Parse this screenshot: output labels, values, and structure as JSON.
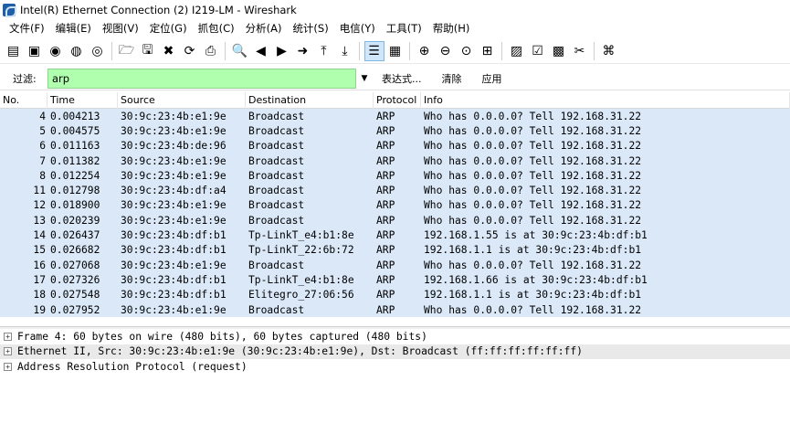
{
  "window": {
    "title": "Intel(R) Ethernet Connection (2) I219-LM - Wireshark"
  },
  "menu": [
    "文件(F)",
    "编辑(E)",
    "视图(V)",
    "定位(G)",
    "抓包(C)",
    "分析(A)",
    "统计(S)",
    "电信(Y)",
    "工具(T)",
    "帮助(H)"
  ],
  "toolbar": {
    "groups": [
      [
        {
          "name": "interfaces-icon",
          "glyph": "▤"
        },
        {
          "name": "capture-options-icon",
          "glyph": "▣"
        },
        {
          "name": "capture-start-icon",
          "glyph": "◉"
        },
        {
          "name": "capture-stop-icon",
          "glyph": "◍"
        },
        {
          "name": "capture-restart-icon",
          "glyph": "◎"
        }
      ],
      [
        {
          "name": "open-file-icon",
          "glyph": "🗁"
        },
        {
          "name": "save-file-icon",
          "glyph": "🖫"
        },
        {
          "name": "close-file-icon",
          "glyph": "✖"
        },
        {
          "name": "reload-icon",
          "glyph": "⟳"
        },
        {
          "name": "print-icon",
          "glyph": "⎙"
        }
      ],
      [
        {
          "name": "find-packet-icon",
          "glyph": "🔍"
        },
        {
          "name": "go-back-icon",
          "glyph": "◀"
        },
        {
          "name": "go-forward-icon",
          "glyph": "▶"
        },
        {
          "name": "go-to-packet-icon",
          "glyph": "➜"
        },
        {
          "name": "go-first-icon",
          "glyph": "⤒"
        },
        {
          "name": "go-last-icon",
          "glyph": "⤓"
        }
      ],
      [
        {
          "name": "colorize-icon",
          "glyph": "☰",
          "active": true
        },
        {
          "name": "autoscroll-icon",
          "glyph": "▦"
        }
      ],
      [
        {
          "name": "zoom-in-icon",
          "glyph": "⊕"
        },
        {
          "name": "zoom-out-icon",
          "glyph": "⊖"
        },
        {
          "name": "zoom-normal-icon",
          "glyph": "⊙"
        },
        {
          "name": "resize-columns-icon",
          "glyph": "⊞"
        }
      ],
      [
        {
          "name": "capture-filters-icon",
          "glyph": "▨"
        },
        {
          "name": "display-filters-icon",
          "glyph": "☑"
        },
        {
          "name": "coloring-rules-icon",
          "glyph": "▩"
        },
        {
          "name": "preferences-icon",
          "glyph": "✂"
        }
      ],
      [
        {
          "name": "help-icon",
          "glyph": "⌘"
        }
      ]
    ]
  },
  "filter": {
    "label": "过滤:",
    "value": "arp",
    "expression_label": "表达式...",
    "clear_label": "清除",
    "apply_label": "应用"
  },
  "packet_list": {
    "columns": [
      "No.",
      "Time",
      "Source",
      "Destination",
      "Protocol",
      "Info"
    ],
    "rows": [
      [
        "4",
        "0.004213",
        "30:9c:23:4b:e1:9e",
        "Broadcast",
        "ARP",
        "Who has 0.0.0.0?  Tell 192.168.31.22"
      ],
      [
        "5",
        "0.004575",
        "30:9c:23:4b:e1:9e",
        "Broadcast",
        "ARP",
        "Who has 0.0.0.0?  Tell 192.168.31.22"
      ],
      [
        "6",
        "0.011163",
        "30:9c:23:4b:de:96",
        "Broadcast",
        "ARP",
        "Who has 0.0.0.0?  Tell 192.168.31.22"
      ],
      [
        "7",
        "0.011382",
        "30:9c:23:4b:e1:9e",
        "Broadcast",
        "ARP",
        "Who has 0.0.0.0?  Tell 192.168.31.22"
      ],
      [
        "8",
        "0.012254",
        "30:9c:23:4b:e1:9e",
        "Broadcast",
        "ARP",
        "Who has 0.0.0.0?  Tell 192.168.31.22"
      ],
      [
        "11",
        "0.012798",
        "30:9c:23:4b:df:a4",
        "Broadcast",
        "ARP",
        "Who has 0.0.0.0?  Tell 192.168.31.22"
      ],
      [
        "12",
        "0.018900",
        "30:9c:23:4b:e1:9e",
        "Broadcast",
        "ARP",
        "Who has 0.0.0.0?  Tell 192.168.31.22"
      ],
      [
        "13",
        "0.020239",
        "30:9c:23:4b:e1:9e",
        "Broadcast",
        "ARP",
        "Who has 0.0.0.0?  Tell 192.168.31.22"
      ],
      [
        "14",
        "0.026437",
        "30:9c:23:4b:df:b1",
        "Tp-LinkT_e4:b1:8e",
        "ARP",
        "192.168.1.55 is at 30:9c:23:4b:df:b1"
      ],
      [
        "15",
        "0.026682",
        "30:9c:23:4b:df:b1",
        "Tp-LinkT_22:6b:72",
        "ARP",
        "192.168.1.1 is at 30:9c:23:4b:df:b1"
      ],
      [
        "16",
        "0.027068",
        "30:9c:23:4b:e1:9e",
        "Broadcast",
        "ARP",
        "Who has 0.0.0.0?  Tell 192.168.31.22"
      ],
      [
        "17",
        "0.027326",
        "30:9c:23:4b:df:b1",
        "Tp-LinkT_e4:b1:8e",
        "ARP",
        "192.168.1.66 is at 30:9c:23:4b:df:b1"
      ],
      [
        "18",
        "0.027548",
        "30:9c:23:4b:df:b1",
        "Elitegro_27:06:56",
        "ARP",
        "192.168.1.1 is at 30:9c:23:4b:df:b1"
      ],
      [
        "19",
        "0.027952",
        "30:9c:23:4b:e1:9e",
        "Broadcast",
        "ARP",
        "Who has 0.0.0.0?  Tell 192.168.31.22"
      ]
    ]
  },
  "details": {
    "lines": [
      "Frame 4: 60 bytes on wire (480 bits), 60 bytes captured (480 bits)",
      "Ethernet II, Src: 30:9c:23:4b:e1:9e (30:9c:23:4b:e1:9e), Dst: Broadcast (ff:ff:ff:ff:ff:ff)",
      "Address Resolution Protocol (request)"
    ],
    "expander_glyph": "+"
  },
  "colors": {
    "row_bg": "#dae8f8",
    "filter_valid_bg": "#afffaf"
  }
}
